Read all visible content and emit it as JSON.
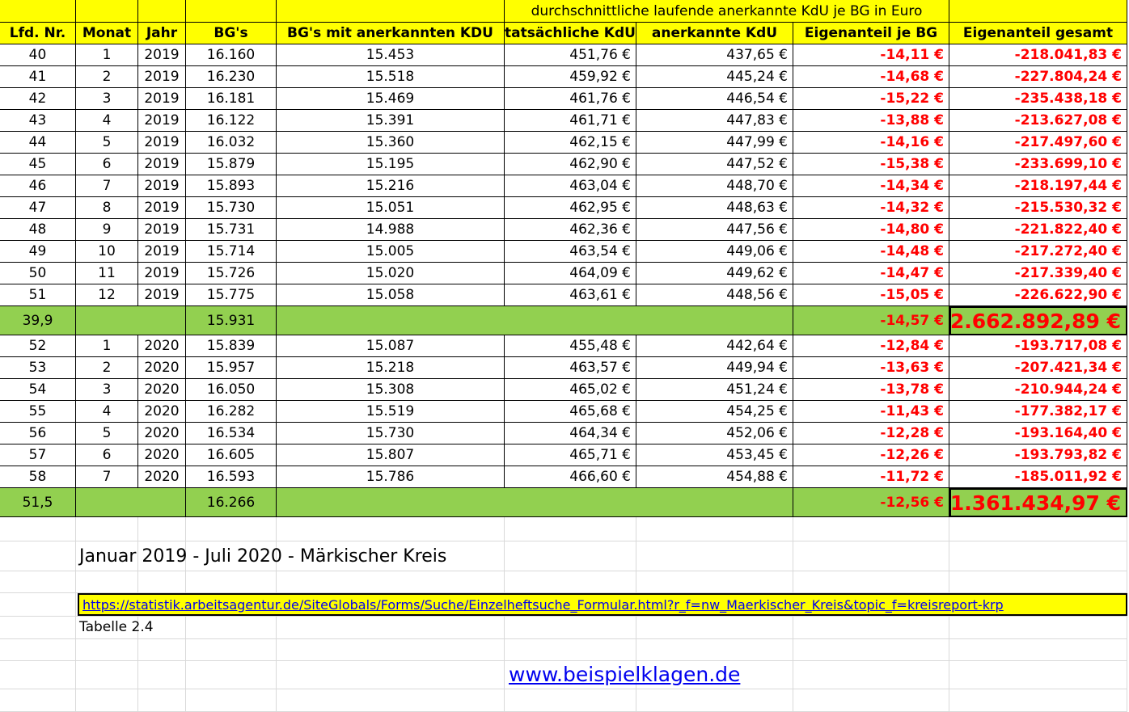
{
  "header_top": "durchschnittliche laufende anerkannte KdU je BG in Euro",
  "columns": [
    "Lfd. Nr.",
    "Monat",
    "Jahr",
    "BG's",
    "BG's mit anerkannten KDU",
    "tatsächliche KdU",
    "anerkannte KdU",
    "Eigenanteil je BG",
    "Eigenanteil gesamt"
  ],
  "rows_2019": [
    [
      "40",
      "1",
      "2019",
      "16.160",
      "15.453",
      "451,76 €",
      "437,65 €",
      "-14,11 €",
      "-218.041,83 €"
    ],
    [
      "41",
      "2",
      "2019",
      "16.230",
      "15.518",
      "459,92 €",
      "445,24 €",
      "-14,68 €",
      "-227.804,24 €"
    ],
    [
      "42",
      "3",
      "2019",
      "16.181",
      "15.469",
      "461,76 €",
      "446,54 €",
      "-15,22 €",
      "-235.438,18 €"
    ],
    [
      "43",
      "4",
      "2019",
      "16.122",
      "15.391",
      "461,71 €",
      "447,83 €",
      "-13,88 €",
      "-213.627,08 €"
    ],
    [
      "44",
      "5",
      "2019",
      "16.032",
      "15.360",
      "462,15 €",
      "447,99 €",
      "-14,16 €",
      "-217.497,60 €"
    ],
    [
      "45",
      "6",
      "2019",
      "15.879",
      "15.195",
      "462,90 €",
      "447,52 €",
      "-15,38 €",
      "-233.699,10 €"
    ],
    [
      "46",
      "7",
      "2019",
      "15.893",
      "15.216",
      "463,04 €",
      "448,70 €",
      "-14,34 €",
      "-218.197,44 €"
    ],
    [
      "47",
      "8",
      "2019",
      "15.730",
      "15.051",
      "462,95 €",
      "448,63 €",
      "-14,32 €",
      "-215.530,32 €"
    ],
    [
      "48",
      "9",
      "2019",
      "15.731",
      "14.988",
      "462,36 €",
      "447,56 €",
      "-14,80 €",
      "-221.822,40 €"
    ],
    [
      "49",
      "10",
      "2019",
      "15.714",
      "15.005",
      "463,54 €",
      "449,06 €",
      "-14,48 €",
      "-217.272,40 €"
    ],
    [
      "50",
      "11",
      "2019",
      "15.726",
      "15.020",
      "464,09 €",
      "449,62 €",
      "-14,47 €",
      "-217.339,40 €"
    ],
    [
      "51",
      "12",
      "2019",
      "15.775",
      "15.058",
      "463,61 €",
      "448,56 €",
      "-15,05 €",
      "-226.622,90 €"
    ]
  ],
  "summary_2019": {
    "lfd": "39,9",
    "bgs": "15.931",
    "eigen_je": "-14,57 €",
    "eigen_gesamt": "-2.662.892,89 €"
  },
  "rows_2020": [
    [
      "52",
      "1",
      "2020",
      "15.839",
      "15.087",
      "455,48 €",
      "442,64 €",
      "-12,84 €",
      "-193.717,08 €"
    ],
    [
      "53",
      "2",
      "2020",
      "15.957",
      "15.218",
      "463,57 €",
      "449,94 €",
      "-13,63 €",
      "-207.421,34 €"
    ],
    [
      "54",
      "3",
      "2020",
      "16.050",
      "15.308",
      "465,02 €",
      "451,24 €",
      "-13,78 €",
      "-210.944,24 €"
    ],
    [
      "55",
      "4",
      "2020",
      "16.282",
      "15.519",
      "465,68 €",
      "454,25 €",
      "-11,43 €",
      "-177.382,17 €"
    ],
    [
      "56",
      "5",
      "2020",
      "16.534",
      "15.730",
      "464,34 €",
      "452,06 €",
      "-12,28 €",
      "-193.164,40 €"
    ],
    [
      "57",
      "6",
      "2020",
      "16.605",
      "15.807",
      "465,71 €",
      "453,45 €",
      "-12,26 €",
      "-193.793,82 €"
    ],
    [
      "58",
      "7",
      "2020",
      "16.593",
      "15.786",
      "466,60 €",
      "454,88 €",
      "-11,72 €",
      "-185.011,92 €"
    ]
  ],
  "summary_2020": {
    "lfd": "51,5",
    "bgs": "16.266",
    "eigen_je": "-12,56 €",
    "eigen_gesamt": "-1.361.434,97 €"
  },
  "caption": "Januar 2019 - Juli 2020 - Märkischer Kreis",
  "source_link": "https://statistik.arbeitsagentur.de/SiteGlobals/Forms/Suche/Einzelheftsuche_Formular.html?r_f=nw_Maerkischer_Kreis&topic_f=kreisreport-krp",
  "table_label": "Tabelle 2.4",
  "website": "www.beispielklagen.de",
  "colors": {
    "header": "#ffff00",
    "summary": "#92d050",
    "negative": "#ff0000",
    "link": "#0000ee"
  }
}
